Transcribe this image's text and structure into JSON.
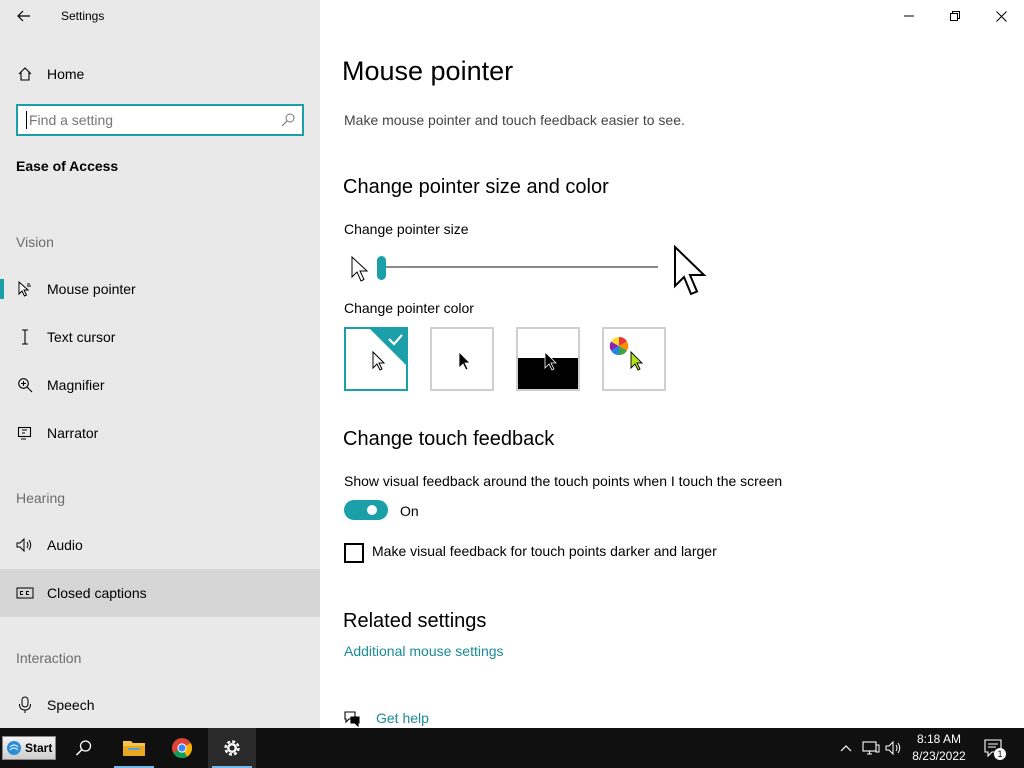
{
  "window": {
    "title": "Settings"
  },
  "sidebar": {
    "home_label": "Home",
    "search_placeholder": "Find a setting",
    "section_title": "Ease of Access",
    "groups": {
      "vision": "Vision",
      "hearing": "Hearing",
      "interaction": "Interaction"
    },
    "items": {
      "mouse_pointer": "Mouse pointer",
      "text_cursor": "Text cursor",
      "magnifier": "Magnifier",
      "narrator": "Narrator",
      "audio": "Audio",
      "closed_captions": "Closed captions",
      "speech": "Speech"
    }
  },
  "main": {
    "title": "Mouse pointer",
    "description": "Make mouse pointer and touch feedback easier to see.",
    "pointer_section": {
      "heading": "Change pointer size and color",
      "size_label": "Change pointer size",
      "size_value": 1,
      "color_label": "Change pointer color",
      "color_options": [
        "white",
        "black",
        "inverted",
        "custom"
      ],
      "selected_color": "white"
    },
    "touch_section": {
      "heading": "Change touch feedback",
      "toggle_description": "Show visual feedback around the touch points when I touch the screen",
      "toggle_state": "On",
      "checkbox_label": "Make visual feedback for touch points darker and larger",
      "checkbox_checked": false
    },
    "related": {
      "heading": "Related settings",
      "link": "Additional mouse settings"
    },
    "help_link": "Get help"
  },
  "taskbar": {
    "start_label": "Start",
    "time": "8:18 AM",
    "date": "8/23/2022",
    "notification_count": "1",
    "pinned": [
      "search-icon",
      "file-explorer-icon",
      "chrome-icon",
      "settings-icon"
    ]
  },
  "colors": {
    "accent": "#1b9fa8",
    "sidebar_bg": "#e9e9e9",
    "taskbar_bg": "#101010"
  }
}
